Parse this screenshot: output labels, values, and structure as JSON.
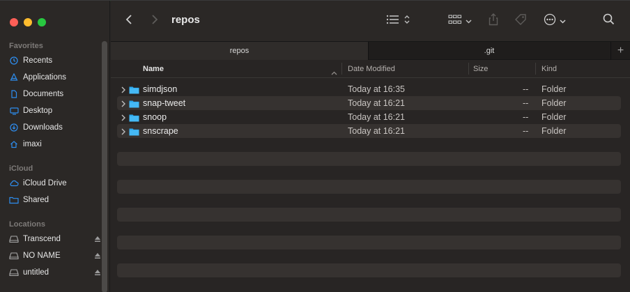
{
  "window": {
    "title": "repos"
  },
  "sidebar": {
    "sections": [
      {
        "label": "Favorites",
        "items": [
          {
            "label": "Recents",
            "icon": "clock-icon"
          },
          {
            "label": "Applications",
            "icon": "applications-icon"
          },
          {
            "label": "Documents",
            "icon": "document-icon"
          },
          {
            "label": "Desktop",
            "icon": "desktop-icon"
          },
          {
            "label": "Downloads",
            "icon": "downloads-icon"
          },
          {
            "label": "imaxi",
            "icon": "home-icon"
          }
        ]
      },
      {
        "label": "iCloud",
        "items": [
          {
            "label": "iCloud Drive",
            "icon": "cloud-icon"
          },
          {
            "label": "Shared",
            "icon": "shared-folder-icon"
          }
        ]
      },
      {
        "label": "Locations",
        "items": [
          {
            "label": "Transcend",
            "icon": "drive-icon",
            "eject": true
          },
          {
            "label": "NO NAME",
            "icon": "drive-icon",
            "eject": true
          },
          {
            "label": "untitled",
            "icon": "drive-icon",
            "eject": true
          }
        ]
      }
    ]
  },
  "tabs": [
    {
      "label": "repos",
      "active": true
    },
    {
      "label": ".git",
      "active": false
    }
  ],
  "tab_add_label": "+",
  "columns": {
    "name": "Name",
    "date": "Date Modified",
    "size": "Size",
    "kind": "Kind"
  },
  "rows": [
    {
      "name": "simdjson",
      "date": "Today at 16:35",
      "size": "--",
      "kind": "Folder"
    },
    {
      "name": "snap-tweet",
      "date": "Today at 16:21",
      "size": "--",
      "kind": "Folder"
    },
    {
      "name": "snoop",
      "date": "Today at 16:21",
      "size": "--",
      "kind": "Folder"
    },
    {
      "name": "snscrape",
      "date": "Today at 16:21",
      "size": "--",
      "kind": "Folder"
    }
  ],
  "colors": {
    "accent": "#2e8ef0",
    "folder": "#2aa6ec",
    "close": "#fe5f57",
    "minimize": "#febc2e",
    "zoom": "#28c840"
  }
}
